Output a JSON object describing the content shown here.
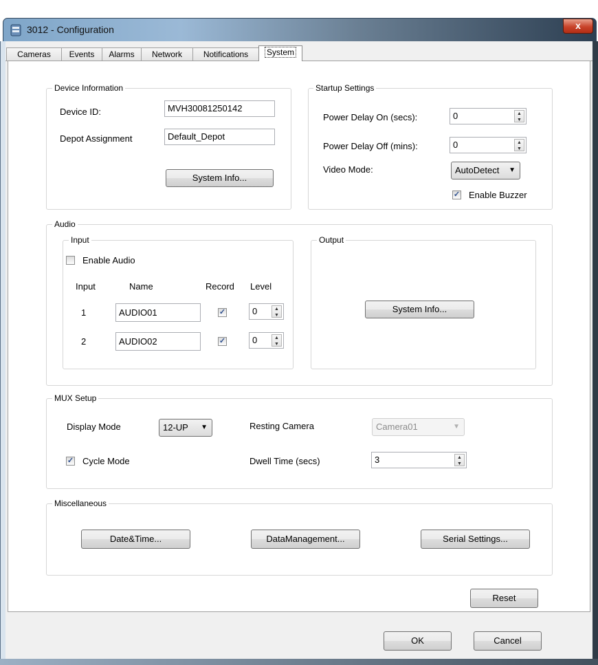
{
  "window": {
    "title": "3012 - Configuration",
    "close_glyph": "x",
    "icon": "app-icon"
  },
  "tabs": [
    {
      "label": "Cameras"
    },
    {
      "label": "Events"
    },
    {
      "label": "Alarms"
    },
    {
      "label": "Network"
    },
    {
      "label": "Notifications"
    },
    {
      "label": "System",
      "active": true
    }
  ],
  "device_info": {
    "legend": "Device Information",
    "device_id_label": "Device ID:",
    "device_id_value": "MVH30081250142",
    "depot_label": "Depot Assignment",
    "depot_value": "Default_Depot",
    "system_info_button": "System Info..."
  },
  "startup": {
    "legend": "Startup Settings",
    "power_on_label": "Power Delay On (secs):",
    "power_on_value": "0",
    "power_off_label": "Power Delay Off (mins):",
    "power_off_value": "0",
    "video_mode_label": "Video Mode:",
    "video_mode_value": "AutoDetect",
    "enable_buzzer_label": "Enable Buzzer",
    "enable_buzzer_checked": true
  },
  "audio": {
    "legend": "Audio",
    "input": {
      "legend": "Input",
      "enable_audio_label": "Enable Audio",
      "enable_audio_checked": false,
      "headers": {
        "input": "Input",
        "name": "Name",
        "record": "Record",
        "level": "Level"
      },
      "rows": [
        {
          "input": "1",
          "name": "AUDIO01",
          "record": true,
          "level": "0"
        },
        {
          "input": "2",
          "name": "AUDIO02",
          "record": true,
          "level": "0"
        }
      ]
    },
    "output": {
      "legend": "Output",
      "system_info_button": "System Info..."
    }
  },
  "mux": {
    "legend": "MUX Setup",
    "display_mode_label": "Display Mode",
    "display_mode_value": "12-UP",
    "resting_camera_label": "Resting Camera",
    "resting_camera_value": "Camera01",
    "cycle_mode_label": "Cycle Mode",
    "cycle_mode_checked": true,
    "dwell_label": "Dwell Time (secs)",
    "dwell_value": "3"
  },
  "misc": {
    "legend": "Miscellaneous",
    "date_time_button": "Date&Time...",
    "data_management_button": "DataManagement...",
    "serial_settings_button": "Serial Settings..."
  },
  "footer": {
    "reset_button": "Reset",
    "ok_button": "OK",
    "cancel_button": "Cancel"
  },
  "glyphs": {
    "check": "✓",
    "dropdown": "▼",
    "spin_up": "▲",
    "spin_down": "▼"
  },
  "colors": {
    "title_gradient_start": "#7fa6c9",
    "title_gradient_end": "#2d3f52",
    "close_red": "#c8432a",
    "check_blue": "#2d4f8e"
  }
}
